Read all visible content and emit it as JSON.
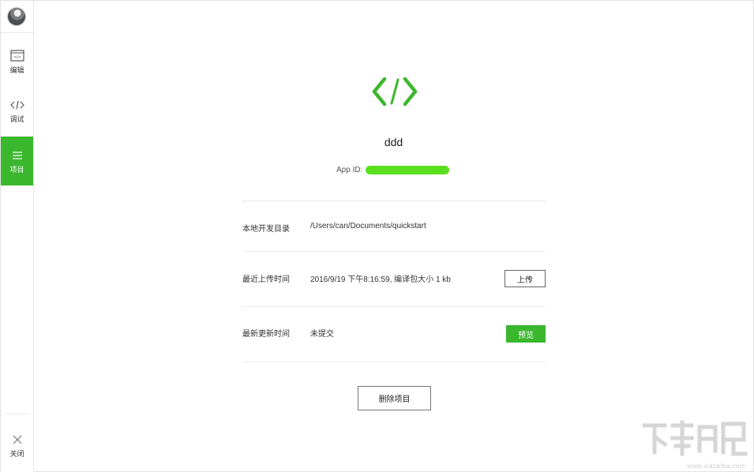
{
  "sidebar": {
    "items": [
      {
        "label": "编辑",
        "icon": "editor-icon"
      },
      {
        "label": "调试",
        "icon": "code-icon"
      },
      {
        "label": "项目",
        "icon": "menu-icon"
      }
    ],
    "close_label": "关闭"
  },
  "project": {
    "name": "ddd",
    "app_id_label": "App ID:",
    "app_id_value": "",
    "rows": [
      {
        "label": "本地开发目录",
        "value": "/Users/can/Documents/quickstart"
      },
      {
        "label": "最近上传时间",
        "value": "2016/9/19 下午8:16:59, 编译包大小 1 kb"
      },
      {
        "label": "最新更新时间",
        "value": "未提交"
      }
    ],
    "upload_label": "上传",
    "preview_label": "预览",
    "delete_label": "删除项目"
  },
  "watermark": {
    "url": "www.xiazaiba.com"
  },
  "colors": {
    "accent": "#3bb72d",
    "appid_mask": "#5ae01e"
  }
}
